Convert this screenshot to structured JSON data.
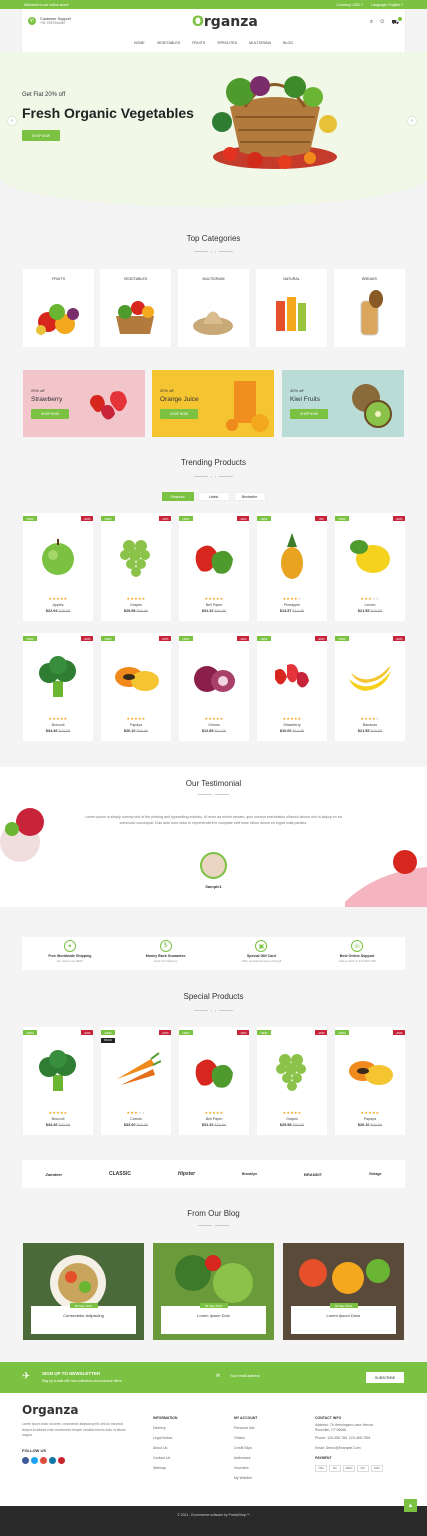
{
  "topbar": {
    "welcome": "Welcome to our online store!",
    "currency": "Currency: USD ˅",
    "language": "Language: English ˅"
  },
  "header": {
    "support_title": "Customer Support",
    "support_phone": "+91 9787244487",
    "logo": "rganza",
    "logo_o": "O",
    "nav": [
      "HOME",
      "VEGETABLES",
      "FRUITS",
      "SPROUTED",
      "MULTIGRAIN",
      "BLOG"
    ]
  },
  "hero": {
    "subtitle": "Get Flat 20% off",
    "title": "Fresh Organic Vegetables",
    "button": "SHOP NOW"
  },
  "categories": {
    "title": "Top Categories",
    "items": [
      "FRUITS",
      "VEGETABLES",
      "MULTIGRAIN",
      "NATURAL",
      "BREADS"
    ]
  },
  "banners": [
    {
      "pct": "20% off",
      "name": "Strawberry",
      "button": "SHOP NOW",
      "bg": "#f2c5cb"
    },
    {
      "pct": "30% off",
      "name": "Orange Juice",
      "button": "SHOP NOW",
      "bg": "#f5c431"
    },
    {
      "pct": "40% off",
      "name": "Kiwi Fruits",
      "button": "SHOP NOW",
      "bg": "#b9dcd7"
    }
  ],
  "trending": {
    "title": "Trending Products",
    "tabs": [
      "Featured",
      "Latest",
      "Bestseller"
    ],
    "products": [
      {
        "name": "Apples",
        "price": "$22.94",
        "old": "$28.68",
        "disc": "-20%",
        "rating": 5,
        "img": "apple"
      },
      {
        "name": "Grapes",
        "price": "$29.58",
        "old": "$34.80",
        "disc": "-15%",
        "rating": 5,
        "img": "grapes"
      },
      {
        "name": "Bell Paper",
        "price": "$31.32",
        "old": "$34.80",
        "disc": "-10%",
        "rating": 5,
        "img": "pepper"
      },
      {
        "name": "Pineapple",
        "price": "$13.57",
        "old": "$14.28",
        "disc": "-5%",
        "rating": 4,
        "img": "pineapple"
      },
      {
        "name": "Lemon",
        "price": "$21.55",
        "old": "$30.80",
        "disc": "-30%",
        "rating": 3,
        "img": "lemon"
      },
      {
        "name": "Broccoli",
        "price": "$34.46",
        "old": "$43.08",
        "disc": "-20%",
        "rating": 5,
        "img": "broccoli"
      },
      {
        "name": "Papaya",
        "price": "$26.10",
        "old": "$34.80",
        "disc": "-25%",
        "rating": 5,
        "img": "papaya"
      },
      {
        "name": "Onions",
        "price": "$12.85",
        "old": "$14.28",
        "disc": "-10%",
        "rating": 5,
        "img": "onion"
      },
      {
        "name": "Strawberry",
        "price": "$10.00",
        "old": "$14.28",
        "disc": "-30%",
        "rating": 5,
        "img": "strawberry"
      },
      {
        "name": "Bananas",
        "price": "$21.55",
        "old": "$30.80",
        "disc": "-30%",
        "rating": 4,
        "img": "banana"
      }
    ]
  },
  "testimonial": {
    "title": "Our Testimonial",
    "text": "Lorem ipsum is simply dummy text of the printing and typesetting industry. Ut enim ad minim veniam, quis nostrud exercitation ullamco laboris nisi ut aliquip ex ea commodo consequat. Duis aute irure dolor in reprehenderit in voluptate velit esse cillum dolore eu fugiat nulla pariatur.",
    "name": "Sample1"
  },
  "features": [
    {
      "title": "Free Worldwide Shipping",
      "desc": "On order over $100",
      "icon": "gift-icon"
    },
    {
      "title": "Money Back Guarantee",
      "desc": "Cash On Delivery",
      "icon": "money-icon"
    },
    {
      "title": "Special Gift Card",
      "desc": "Offer special bonuses with gift",
      "icon": "gift-card-icon"
    },
    {
      "title": "Best Online Support",
      "desc": "Call us 24/7 at 123-456-789",
      "icon": "support-icon"
    }
  ],
  "special": {
    "title": "Special Products",
    "products": [
      {
        "name": "Broccoli",
        "price": "$34.46",
        "old": "$43.08",
        "disc": "-20%",
        "rating": 5,
        "img": "broccoli"
      },
      {
        "name": "Carrots",
        "price": "$33.60",
        "old": "$42.00",
        "disc": "-20%",
        "rating": 3,
        "img": "carrot",
        "pack": "PACK"
      },
      {
        "name": "Bell Paper",
        "price": "$31.32",
        "old": "$34.80",
        "disc": "-10%",
        "rating": 5,
        "img": "pepper"
      },
      {
        "name": "Grapes",
        "price": "$29.58",
        "old": "$34.80",
        "disc": "-15%",
        "rating": 5,
        "img": "grapes"
      },
      {
        "name": "Papaya",
        "price": "$26.10",
        "old": "$34.80",
        "disc": "-25%",
        "rating": 5,
        "img": "papaya"
      }
    ]
  },
  "brands": [
    "Zaindeer",
    "CLASSIC",
    "Hipster",
    "Brooklyn",
    "BRANDIT",
    "Vintage"
  ],
  "blog": {
    "title": "From Our Blog",
    "posts": [
      {
        "date": "06 May 2021",
        "title": "Consectetur Adipiscing"
      },
      {
        "date": "06 May 2021",
        "title": "Lorem Ipsum Dolo"
      },
      {
        "date": "06 May 2021",
        "title": "Lorem Ipsum Dolor"
      }
    ]
  },
  "newsletter": {
    "title": "SIGN UP TO NEWSLETTER",
    "desc": "Stay up to date with new collections and exclusive offers.",
    "placeholder": "Your email address",
    "button": "SUBSCRIBE"
  },
  "footer": {
    "logo": "Organza",
    "about": "Lorem ipsum dolor sit amet, consectetur adipiscing elit, sed do eiusmod tempor incididunt enim consectetur tempor incididunt enim dolor ut labore magna.",
    "follow": "FOLLOW US",
    "info_title": "INFORMATION",
    "info": [
      "Delivery",
      "Legal Notice",
      "About Us",
      "Contact Us",
      "Sitemap"
    ],
    "account_title": "MY ACCOUNT",
    "account": [
      "Personal Info",
      "Orders",
      "Credit Slips",
      "Addresses",
      "Vouchers",
      "My Wishlist"
    ],
    "contact_title": "CONTACT INFO",
    "contact": [
      "Address: 76 Hennington Lane Vernon",
      "Rockville, CT 06066",
      "Phone: 123-456-789, 123-456-7891",
      "Email: Demo@Example.Com"
    ],
    "payment_title": "PAYMENT",
    "payments": [
      "VISA",
      "MC",
      "AMEX",
      "PAY",
      "DISC"
    ]
  },
  "copyright": "© 2021 - Ecommerce software by PrestaShop™",
  "colors": {
    "accent": "#7cc242",
    "discount": "#c7243a"
  }
}
